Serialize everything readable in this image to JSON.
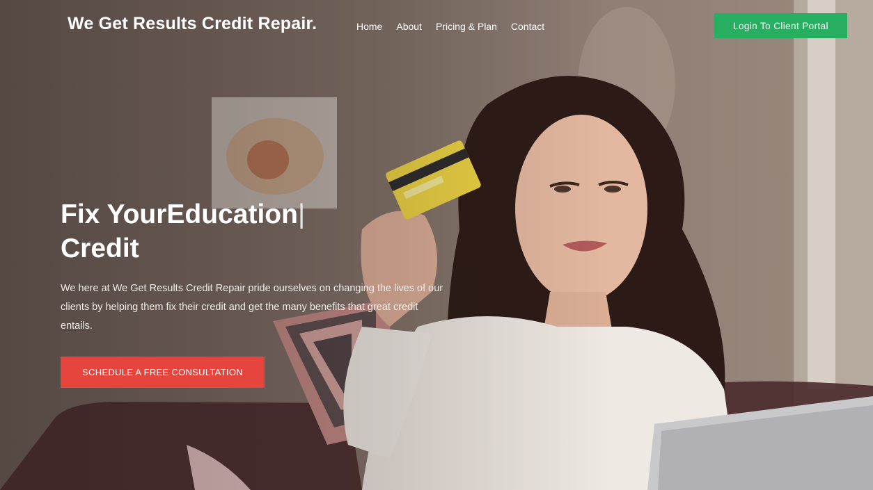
{
  "header": {
    "brand": "We Get Results Credit Repair.",
    "nav": [
      {
        "label": "Home"
      },
      {
        "label": "About"
      },
      {
        "label": "Pricing & Plan"
      },
      {
        "label": "Contact"
      }
    ],
    "login_label": "Login To Client Portal"
  },
  "hero": {
    "headline_part1": "Fix Your",
    "headline_typed": "Education",
    "headline_cursor": "|",
    "headline_part2": "Credit",
    "description": "We here at We Get Results Credit Repair pride ourselves on changing the lives of our clients by helping them fix their credit and get the many benefits that great credit entails.",
    "cta_label": "SCHEDULE A FREE CONSULTATION"
  },
  "colors": {
    "login_button": "#27ae60",
    "cta_button": "#e5453c"
  }
}
